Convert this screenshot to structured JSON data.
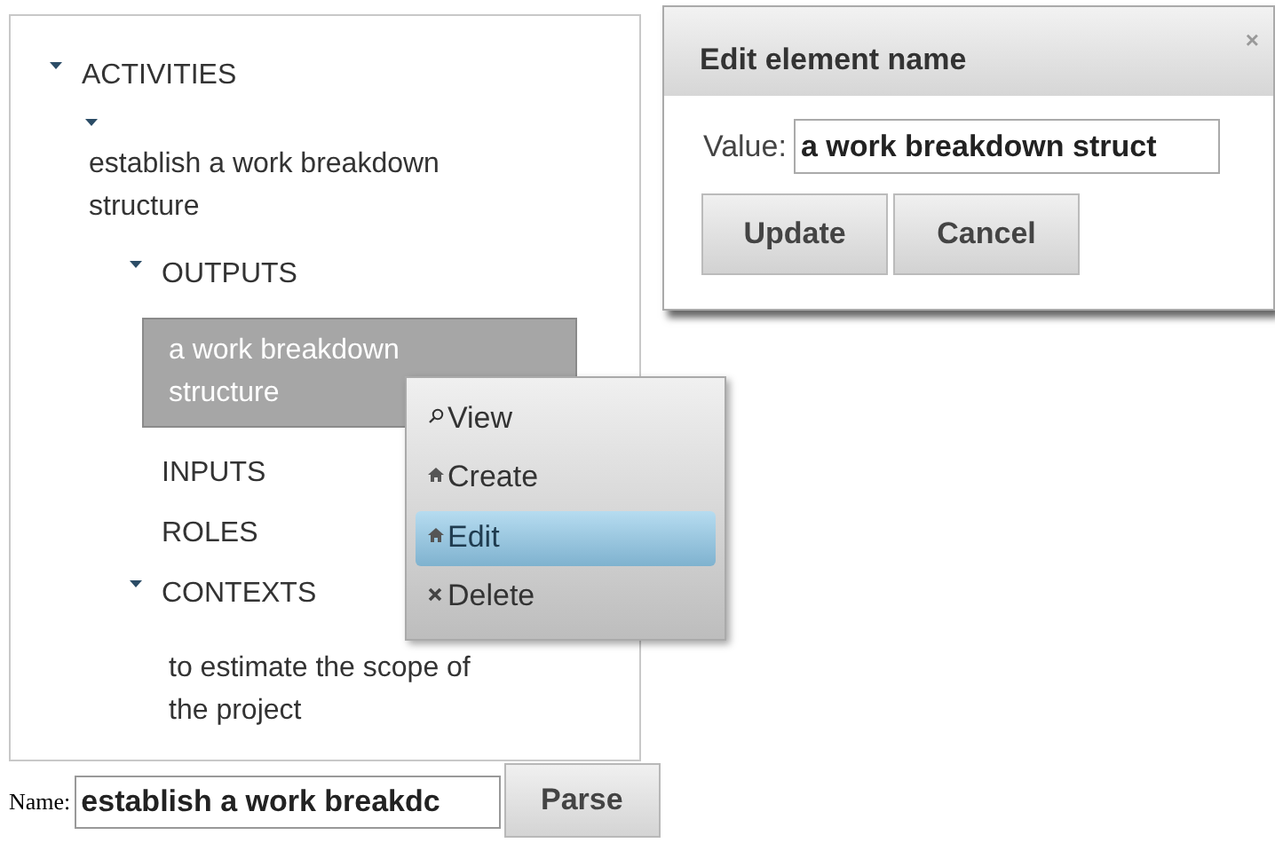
{
  "tree": [
    {
      "label": "ACTIVITIES",
      "expanded": true,
      "children": [
        {
          "label": "establish a work breakdown structure",
          "expanded": true,
          "children": [
            {
              "label": "OUTPUTS",
              "expanded": true,
              "children": [
                {
                  "label": "a work breakdown structure",
                  "selected": true
                }
              ]
            },
            {
              "label": "INPUTS",
              "expanded": false
            },
            {
              "label": "ROLES",
              "expanded": false
            },
            {
              "label": "CONTEXTS",
              "expanded": true,
              "children": [
                {
                  "label": "to estimate the scope of the project",
                  "selected": false
                }
              ]
            }
          ]
        }
      ]
    }
  ],
  "context_menu": [
    {
      "kind": "search",
      "label": "View",
      "selected": false
    },
    {
      "kind": "home",
      "label": "Create",
      "selected": false
    },
    {
      "kind": "home",
      "label": "Edit",
      "selected": true
    },
    {
      "kind": "close",
      "label": "Delete",
      "selected": false
    }
  ],
  "dialog": {
    "title": "Edit element name",
    "close": "×",
    "field_label": "Value:",
    "value": "a work breakdown struct",
    "buttons": [
      "Update",
      "Cancel"
    ]
  },
  "name_row": {
    "label": "Name:",
    "value": "establish a work breakdc",
    "button": "Parse"
  }
}
